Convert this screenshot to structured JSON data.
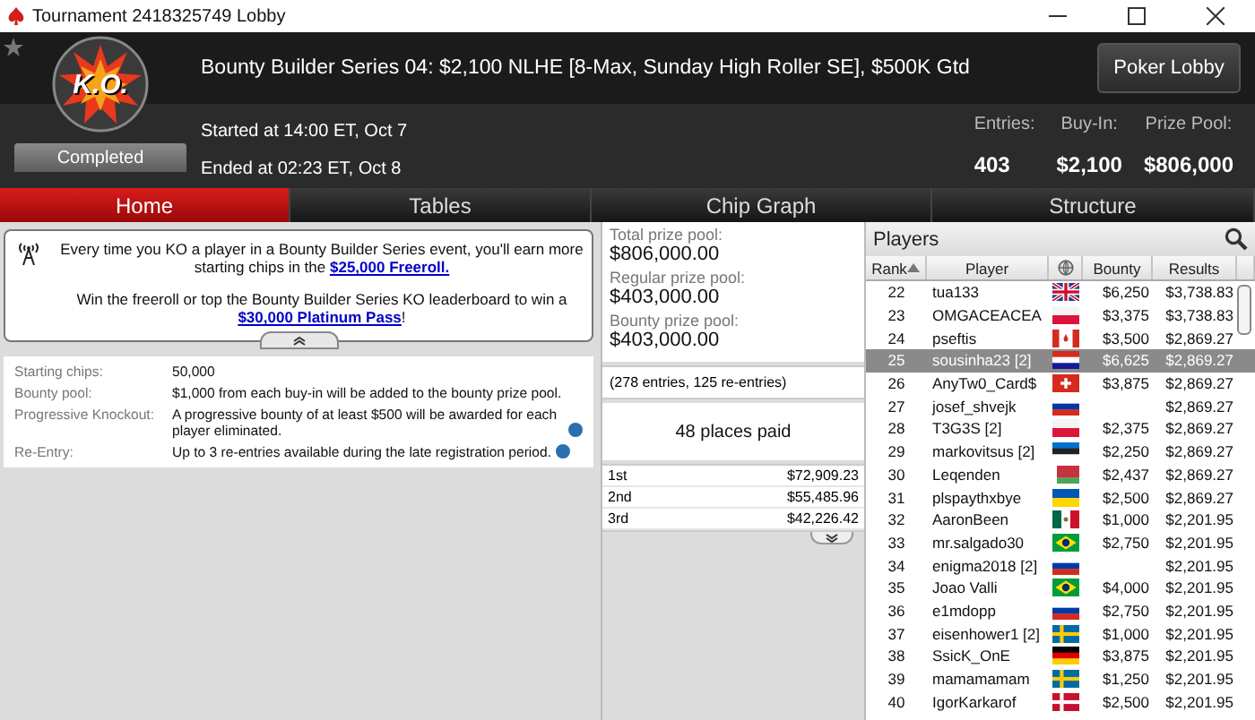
{
  "window": {
    "title": "Tournament 2418325749 Lobby"
  },
  "header": {
    "logo": "K.O.",
    "status": "Completed",
    "title": "Bounty Builder Series 04: $2,100 NLHE [8-Max, Sunday High Roller SE], $500K Gtd",
    "started": "Started at 14:00 ET, Oct 7",
    "ended": "Ended at 02:23 ET, Oct 8",
    "button": "Poker Lobby",
    "stats": [
      {
        "label": "Entries:",
        "value": "403"
      },
      {
        "label": "Buy-In:",
        "value": "$2,100"
      },
      {
        "label": "Prize Pool:",
        "value": "$806,000"
      }
    ]
  },
  "tabs": [
    {
      "label": "Home",
      "selected": true
    },
    {
      "label": "Tables",
      "selected": false
    },
    {
      "label": "Chip Graph",
      "selected": false
    },
    {
      "label": "Structure",
      "selected": false
    }
  ],
  "notice": {
    "paragraphs": [
      {
        "text": "Every time you KO a player in a Bounty Builder Series event, you'll earn more starting chips in the ",
        "link": "$25,000 Freeroll."
      },
      {
        "text": "Win the freeroll or top the Bounty Builder Series KO leaderboard to win a ",
        "link": "$30,000 Platinum Pass",
        "after": "!"
      }
    ]
  },
  "details": [
    {
      "label": "Starting chips:",
      "value": "50,000",
      "info": false
    },
    {
      "label": "Bounty pool:",
      "value": "$1,000 from each buy-in will be added to the bounty prize pool.",
      "info": false
    },
    {
      "label": "Progressive Knockout:",
      "value": "A progressive bounty of at least $500 will be awarded for each player eliminated.",
      "info": true
    },
    {
      "label": "Re-Entry:",
      "value": "Up to 3 re-entries available during the late registration period.",
      "info": true
    }
  ],
  "prizes": {
    "pools": [
      {
        "label": "Total prize pool:",
        "value": "$806,000.00"
      },
      {
        "label": "Regular prize pool:",
        "value": "$403,000.00"
      },
      {
        "label": "Bounty prize pool:",
        "value": "$403,000.00"
      }
    ],
    "entries": "(278 entries, 125 re-entries)",
    "paid": "48 places paid",
    "places": [
      {
        "place": "1st",
        "amount": "$72,909.23"
      },
      {
        "place": "2nd",
        "amount": "$55,485.96"
      },
      {
        "place": "3rd",
        "amount": "$42,226.42"
      }
    ]
  },
  "players": {
    "title": "Players",
    "columns": [
      "Rank",
      "Player",
      "Bounty",
      "Results"
    ],
    "rows": [
      {
        "rank": "22",
        "name": "tua133",
        "flag": {
          "kind": "gb"
        },
        "bounty": "$6,250",
        "result": "$3,738.83",
        "selected": false
      },
      {
        "rank": "23",
        "name": "OMGACEACEA",
        "flag": {
          "kind": "pl"
        },
        "bounty": "$3,375",
        "result": "$3,738.83",
        "selected": false
      },
      {
        "rank": "24",
        "name": "pseftis",
        "flag": {
          "kind": "ca"
        },
        "bounty": "$3,500",
        "result": "$2,869.27",
        "selected": false
      },
      {
        "rank": "25",
        "name": "sousinha23 [2]",
        "flag": {
          "kind": "hr"
        },
        "bounty": "$6,625",
        "result": "$2,869.27",
        "selected": true
      },
      {
        "rank": "26",
        "name": "AnyTw0_Card$",
        "flag": {
          "kind": "ch"
        },
        "bounty": "$3,875",
        "result": "$2,869.27",
        "selected": false
      },
      {
        "rank": "27",
        "name": "josef_shvejk",
        "flag": {
          "kind": "ru"
        },
        "result": "$2,869.27",
        "selected": false
      },
      {
        "rank": "28",
        "name": "T3G3S [2]",
        "flag": {
          "kind": "pl"
        },
        "bounty": "$2,375",
        "result": "$2,869.27",
        "selected": false
      },
      {
        "rank": "29",
        "name": "markovitsus [2]",
        "flag": {
          "kind": "ee"
        },
        "bounty": "$2,250",
        "result": "$2,869.27",
        "selected": false
      },
      {
        "rank": "30",
        "name": "Leqenden",
        "flag": {
          "kind": "by"
        },
        "bounty": "$2,437",
        "result": "$2,869.27",
        "selected": false
      },
      {
        "rank": "31",
        "name": "plspaythxbye",
        "flag": {
          "kind": "ua"
        },
        "bounty": "$2,500",
        "result": "$2,869.27",
        "selected": false
      },
      {
        "rank": "32",
        "name": "AaronBeen",
        "flag": {
          "kind": "mx"
        },
        "bounty": "$1,000",
        "result": "$2,201.95",
        "selected": false
      },
      {
        "rank": "33",
        "name": "mr.salgado30",
        "flag": {
          "kind": "br"
        },
        "bounty": "$2,750",
        "result": "$2,201.95",
        "selected": false
      },
      {
        "rank": "34",
        "name": "enigma2018 [2]",
        "flag": {
          "kind": "ru"
        },
        "result": "$2,201.95",
        "selected": false
      },
      {
        "rank": "35",
        "name": "Joao Valli",
        "flag": {
          "kind": "br"
        },
        "bounty": "$4,000",
        "result": "$2,201.95",
        "selected": false
      },
      {
        "rank": "36",
        "name": "e1mdopp",
        "flag": {
          "kind": "ru"
        },
        "bounty": "$2,750",
        "result": "$2,201.95",
        "selected": false
      },
      {
        "rank": "37",
        "name": "eisenhower1 [2]",
        "flag": {
          "kind": "se"
        },
        "bounty": "$1,000",
        "result": "$2,201.95",
        "selected": false
      },
      {
        "rank": "38",
        "name": "SsicK_OnE",
        "flag": {
          "kind": "de"
        },
        "bounty": "$3,875",
        "result": "$2,201.95",
        "selected": false
      },
      {
        "rank": "39",
        "name": "mamamamam",
        "flag": {
          "kind": "se"
        },
        "bounty": "$1,250",
        "result": "$2,201.95",
        "selected": false
      },
      {
        "rank": "40",
        "name": "IgorKarkarof",
        "flag": {
          "kind": "dk"
        },
        "bounty": "$2,500",
        "result": "$2,201.95",
        "selected": false
      }
    ]
  }
}
